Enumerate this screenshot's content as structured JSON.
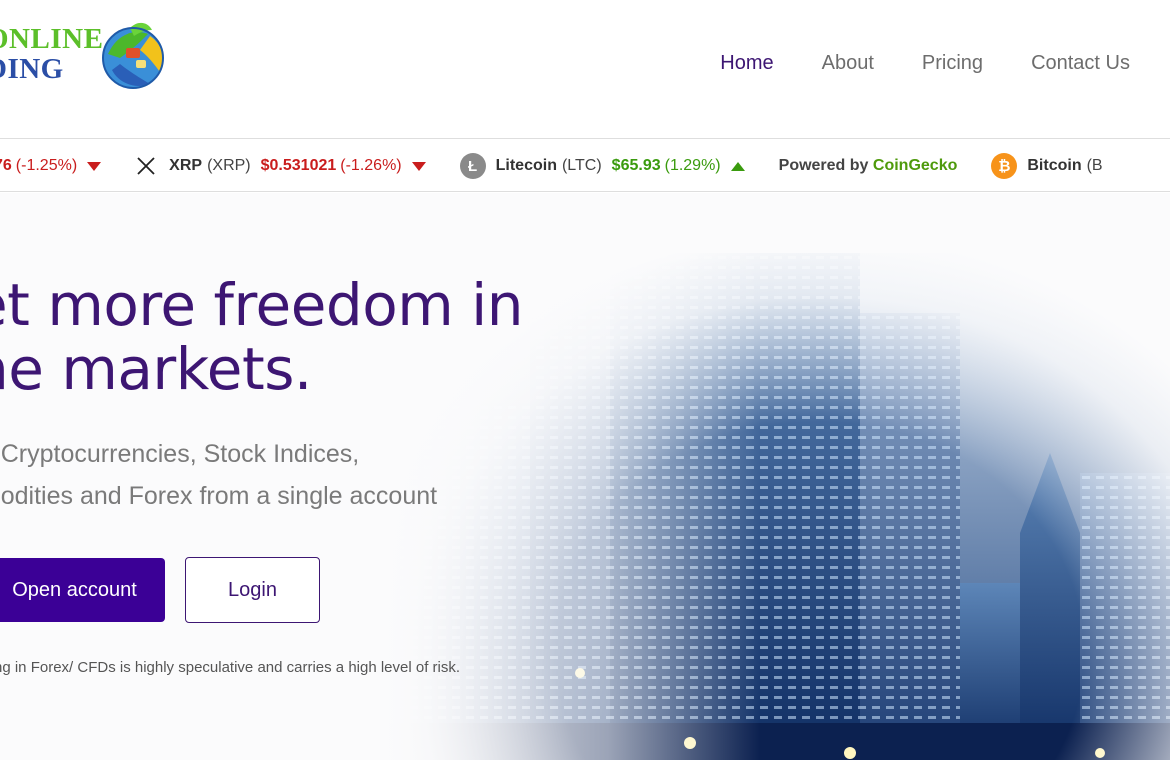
{
  "header": {
    "logo": {
      "line1": "ONLINE",
      "line2": "DING",
      "name": "logo-globe-icon"
    },
    "nav": [
      {
        "label": "Home",
        "active": true
      },
      {
        "label": "About",
        "active": false
      },
      {
        "label": "Pricing",
        "active": false
      },
      {
        "label": "Contact Us",
        "active": false
      }
    ]
  },
  "ticker": {
    "items": [
      {
        "name": "",
        "symbol": "",
        "price": "76",
        "change": "(-1.25%)",
        "direction": "down",
        "icon": ""
      },
      {
        "name": "XRP",
        "symbol": "(XRP)",
        "price": "$0.531021",
        "change": "(-1.26%)",
        "direction": "down",
        "icon": "xrp-icon"
      },
      {
        "name": "Litecoin",
        "symbol": "(LTC)",
        "price": "$65.93",
        "change": "(1.29%)",
        "direction": "up",
        "icon": "litecoin-icon"
      }
    ],
    "powered_by": {
      "prefix": "Powered by",
      "brand": "CoinGecko"
    },
    "trailing": {
      "name": "Bitcoin",
      "symbol": "(B",
      "icon": "bitcoin-icon"
    },
    "colors": {
      "down": "#c91d1d",
      "up": "#3a9b0e"
    }
  },
  "hero": {
    "headline_line1": "et more freedom in",
    "headline_line2": "he markets.",
    "sub_line1": "de Cryptocurrencies, Stock Indices,",
    "sub_line2": "nmodities and Forex from a single account",
    "open_account_label": "Open account",
    "login_label": "Login",
    "risk_text": "ng in Forex/ CFDs is highly speculative and carries a high level of risk.",
    "accent": "#3b0096",
    "headline_color": "#3d1673"
  }
}
